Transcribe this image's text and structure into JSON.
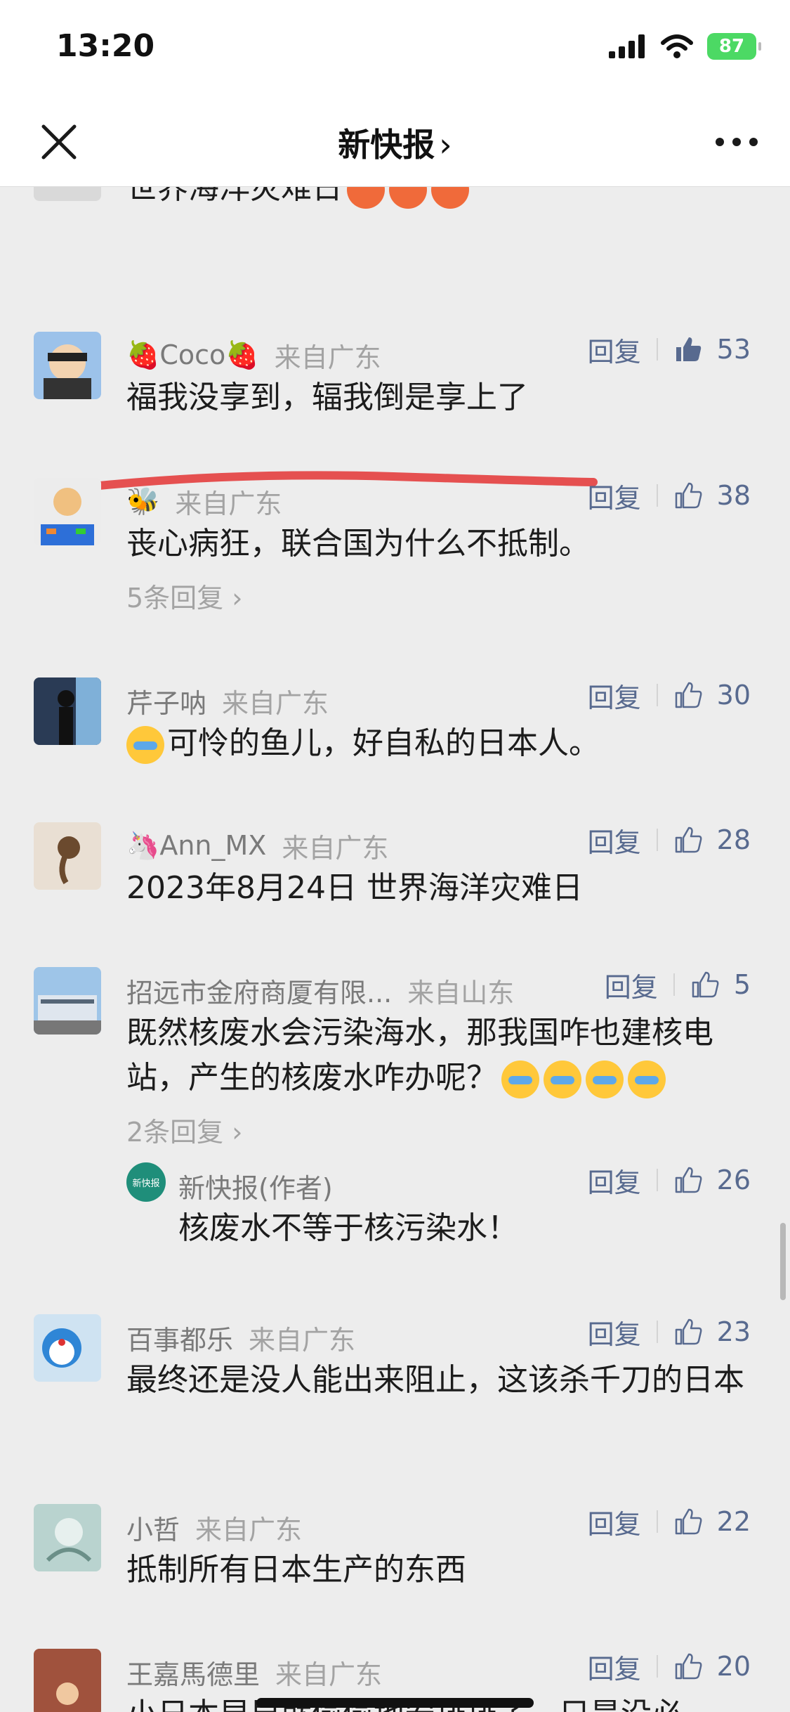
{
  "status": {
    "time": "13:20",
    "battery": "87"
  },
  "nav": {
    "title": "新快报",
    "chevron": "›"
  },
  "top_partial": {
    "text": "世界海洋灾难日"
  },
  "comments": [
    {
      "name": "Coco",
      "location": "来自广东",
      "reply": "回复",
      "likes": "53",
      "text": "福我没享到，辐我倒是享上了",
      "liked": true
    },
    {
      "name": "",
      "location": "来自广东",
      "reply": "回复",
      "likes": "38",
      "text": "丧心病狂，联合国为什么不抵制。",
      "more_replies": "5条回复"
    },
    {
      "name": "芹子呐",
      "location": "来自广东",
      "reply": "回复",
      "likes": "30",
      "text": "可怜的鱼儿，好自私的日本人。"
    },
    {
      "name": "Ann_MX",
      "location": "来自广东",
      "reply": "回复",
      "likes": "28",
      "text": "2023年8月24日 世界海洋灾难日"
    },
    {
      "name": "招远市金府商厦有限...",
      "location": "来自山东",
      "reply": "回复",
      "likes": "5",
      "text": "既然核废水会污染海水，那我国咋也建核电站，产生的核废水咋办呢？",
      "more_replies": "2条回复"
    },
    {
      "name": "新快报(作者)",
      "location": "",
      "reply": "回复",
      "likes": "26",
      "text": "核废水不等于核污染水！",
      "avatar_text": "新快报"
    },
    {
      "name": "百事都乐",
      "location": "来自广东",
      "reply": "回复",
      "likes": "23",
      "text": "最终还是没人能出来阻止，这该杀千刀的日本"
    },
    {
      "name": "小哲",
      "location": "来自广东",
      "reply": "回复",
      "likes": "22",
      "text": "抵制所有日本生产的东西"
    },
    {
      "name": "王嘉馬德里",
      "location": "来自广东",
      "reply": "回复",
      "likes": "20",
      "text": "小日本早早就偷偷地安排排了，只是没必"
    }
  ],
  "icons": {
    "close": "close-icon",
    "more": "more-icon",
    "like": "thumb-up-icon"
  }
}
